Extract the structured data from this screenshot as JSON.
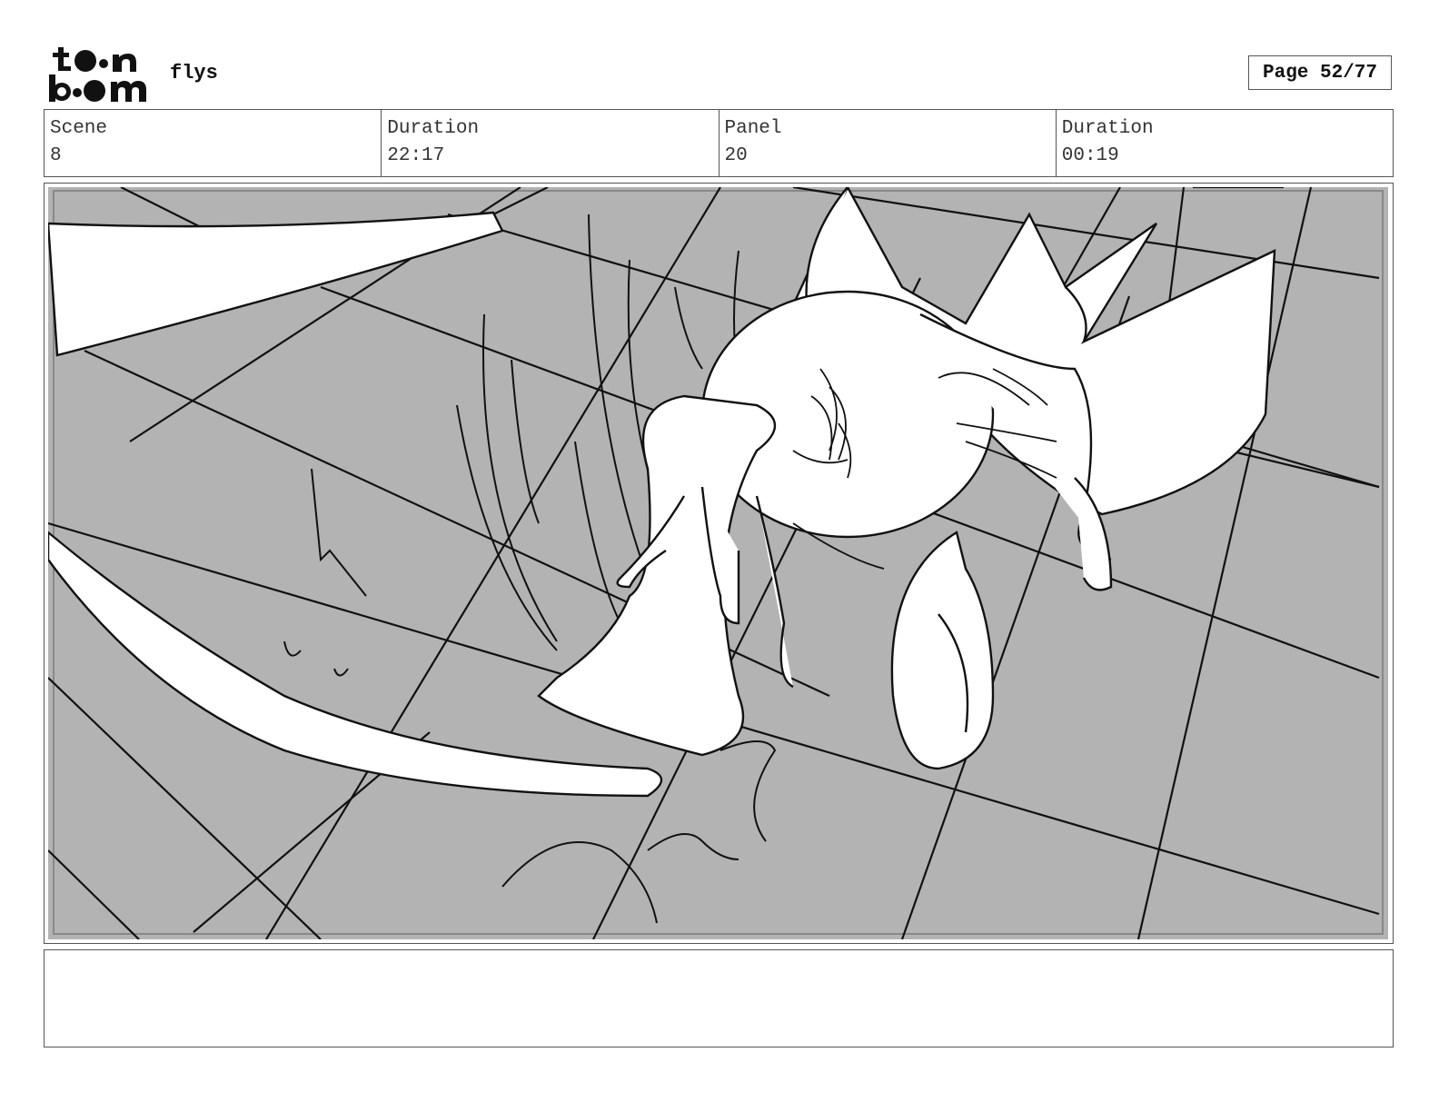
{
  "header": {
    "logo_text": "toonboom",
    "project_title": "flys",
    "page_label": "Page 52/77"
  },
  "info": {
    "scene_label": "Scene",
    "scene_value": "8",
    "scene_duration_label": "Duration",
    "scene_duration_value": "22:17",
    "panel_label": "Panel",
    "panel_value": "20",
    "panel_duration_label": "Duration",
    "panel_duration_value": "00:19"
  },
  "panel": {
    "image_name": "storyboard-sketch",
    "background_color": "#b3b3b3"
  },
  "notes": {
    "text": ""
  }
}
